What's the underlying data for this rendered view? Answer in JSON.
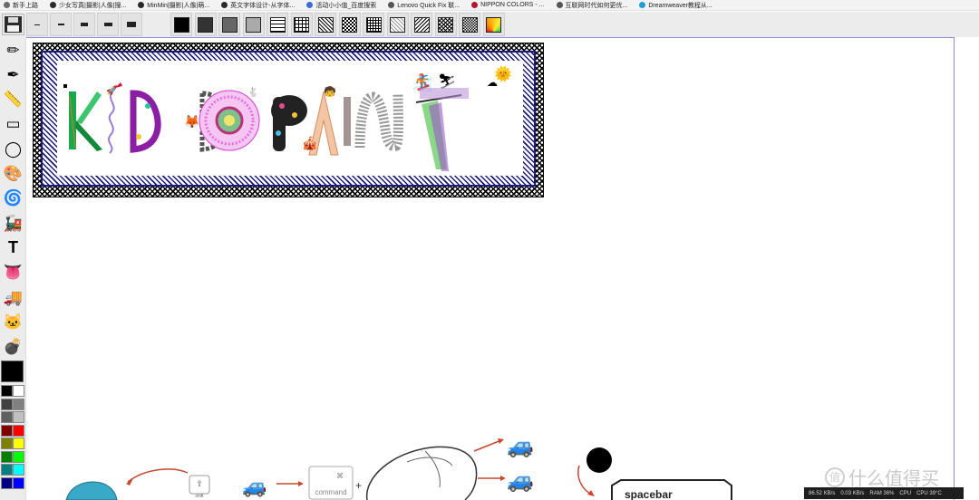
{
  "bookmarks": [
    {
      "label": "新手上路",
      "color": "#6b6b6b"
    },
    {
      "label": "少女写真|摄影|人像|搜...",
      "color": "#2a2a2a"
    },
    {
      "label": "MinMin|摄影|人像|萌...",
      "color": "#2a2a2a"
    },
    {
      "label": "英文字体设计-从字体...",
      "color": "#2a2a2a"
    },
    {
      "label": "活动小小值_百度搜索",
      "color": "#3b6fd8"
    },
    {
      "label": "Lenovo Quick Fix 联...",
      "color": "#555555"
    },
    {
      "label": "NIPPON COLORS - ...",
      "color": "#b0182c"
    },
    {
      "label": "互联网时代如何更优...",
      "color": "#555555"
    },
    {
      "label": "Dreamweaver教程从...",
      "color": "#1ea0d6"
    }
  ],
  "toolbar": {
    "save_icon": "floppy-disk-icon",
    "brush_sizes": [
      "line-1",
      "line-2",
      "line-3",
      "line-4",
      "line-5"
    ],
    "fill_patterns": [
      "solid-black",
      "dark-gray",
      "mid-gray",
      "light-gray",
      "bricks",
      "crosshatch",
      "dots",
      "checker",
      "grid",
      "fine",
      "weave",
      "diagonal",
      "dense",
      "rainbow"
    ]
  },
  "tools": [
    {
      "name": "pencil-icon",
      "glyph": "✏"
    },
    {
      "name": "pen-icon",
      "glyph": "✒"
    },
    {
      "name": "ruler-icon",
      "glyph": "📏"
    },
    {
      "name": "rectangle-icon",
      "glyph": "▭"
    },
    {
      "name": "circle-icon",
      "glyph": "◯"
    },
    {
      "name": "palette-icon",
      "glyph": "🎨"
    },
    {
      "name": "swirl-icon",
      "glyph": "🌀"
    },
    {
      "name": "train-icon",
      "glyph": "🚂"
    },
    {
      "name": "text-icon",
      "glyph": "T"
    },
    {
      "name": "tongue-icon",
      "glyph": "👅"
    },
    {
      "name": "truck-icon",
      "glyph": "🚚"
    },
    {
      "name": "fox-icon",
      "glyph": "🐱"
    },
    {
      "name": "bomb-icon",
      "glyph": "💣"
    }
  ],
  "palette": {
    "current_color": "#000000",
    "colors": [
      "#000000",
      "#ffffff",
      "#404040",
      "#808080",
      "#606060",
      "#c0c0c0",
      "#800000",
      "#ff0000",
      "#808000",
      "#ffff00",
      "#008000",
      "#00ff00",
      "#008080",
      "#00ffff",
      "#000080",
      "#0000ff"
    ]
  },
  "canvas": {
    "logo_letters": [
      "K",
      "I",
      "D",
      "D",
      "O",
      "P",
      "A",
      "I",
      "N",
      "T"
    ],
    "logo_colors": [
      "#1aa64a",
      "#8a5ac9",
      "#9b2db4",
      "#555555",
      "#e66fe2",
      "#e84a8f",
      "#f2a37a",
      "#9a9a9a",
      "#9a9a9a",
      "#7dd47a"
    ]
  },
  "status": {
    "down_speed": "86.52 KB/s",
    "up_speed": "0.03 KB/s",
    "ram": "RAM 36%",
    "cpu_label": "CPU",
    "cpu_temp": "CPU 39°C"
  },
  "watermark": {
    "badge": "值",
    "text": "什么值得买"
  },
  "drawing": {
    "key_shift": "shift",
    "key_command": "command",
    "key_symbol": "⌘",
    "plus": "+",
    "spacebar": "spacebar"
  }
}
